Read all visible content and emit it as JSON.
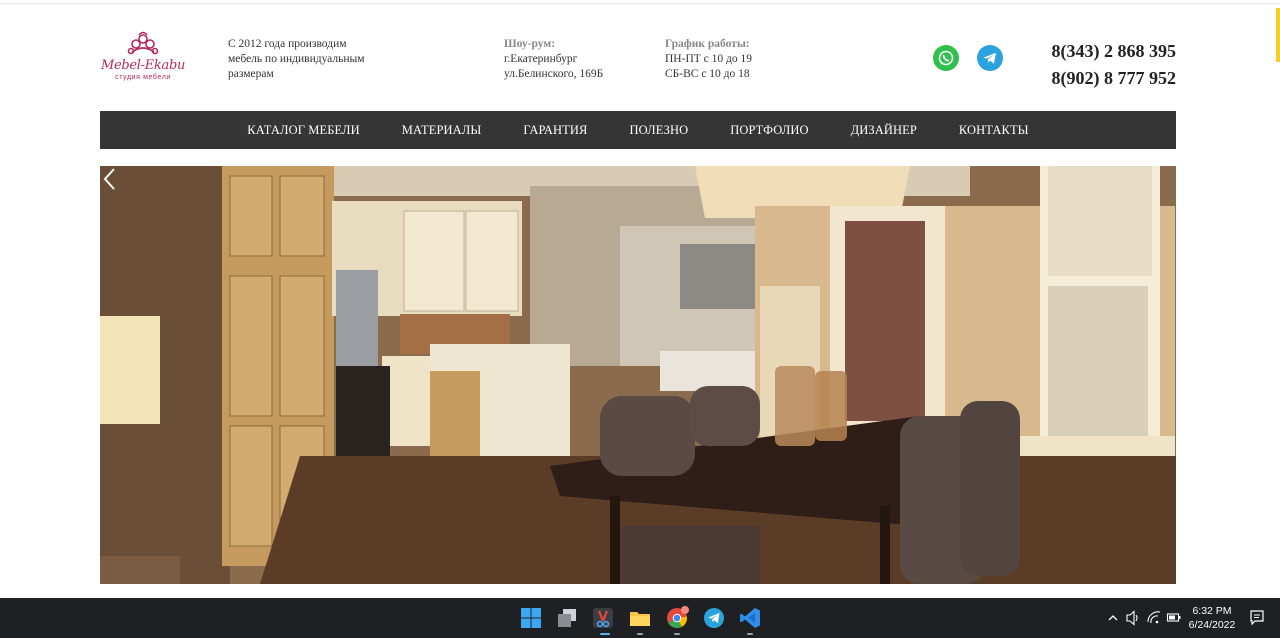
{
  "brand": {
    "name": "Mebel-Ekabu",
    "subtitle": "студия мебели",
    "color": "#b32a5e"
  },
  "header": {
    "tagline": [
      "С 2012 года производим",
      "мебель по индивидуальным",
      "размерам"
    ],
    "showroom": {
      "label": "Шоу-рум:",
      "lines": [
        "г.Екатеринбург",
        "ул.Белинского, 169Б"
      ]
    },
    "hours": {
      "label": "График работы:",
      "lines": [
        "ПН-ПТ с 10 до 19",
        "СБ-ВС с 10 до 18"
      ]
    },
    "social": [
      {
        "icon": "whatsapp-icon",
        "color": "#2fc04e"
      },
      {
        "icon": "telegram-icon",
        "color": "#2aa3dc"
      }
    ],
    "phones": [
      "8(343) 2 868 395",
      "8(902) 8 777 952"
    ]
  },
  "nav": {
    "items": [
      "КАТАЛОГ МЕБЕЛИ",
      "МАТЕРИАЛЫ",
      "ГАРАНТИЯ",
      "ПОЛЕЗНО",
      "ПОРТФОЛИО",
      "ДИЗАЙНЕР",
      "КОНТАКТЫ"
    ],
    "background": "#353535"
  },
  "hero": {
    "image": "dining-room-kitchen-photo",
    "prev_icon": "chevron-left-icon"
  },
  "taskbar": {
    "icons": [
      "windows-start-icon",
      "task-view-icon",
      "snipping-tool-icon",
      "file-explorer-icon",
      "chrome-icon",
      "telegram-icon",
      "vscode-icon"
    ],
    "tray_icons": [
      "chevron-up-icon",
      "volume-icon",
      "wifi-icon",
      "battery-icon"
    ],
    "time": "6:32 PM",
    "date": "6/24/2022",
    "notification_icon": "notification-icon",
    "background": "#1f2023"
  }
}
